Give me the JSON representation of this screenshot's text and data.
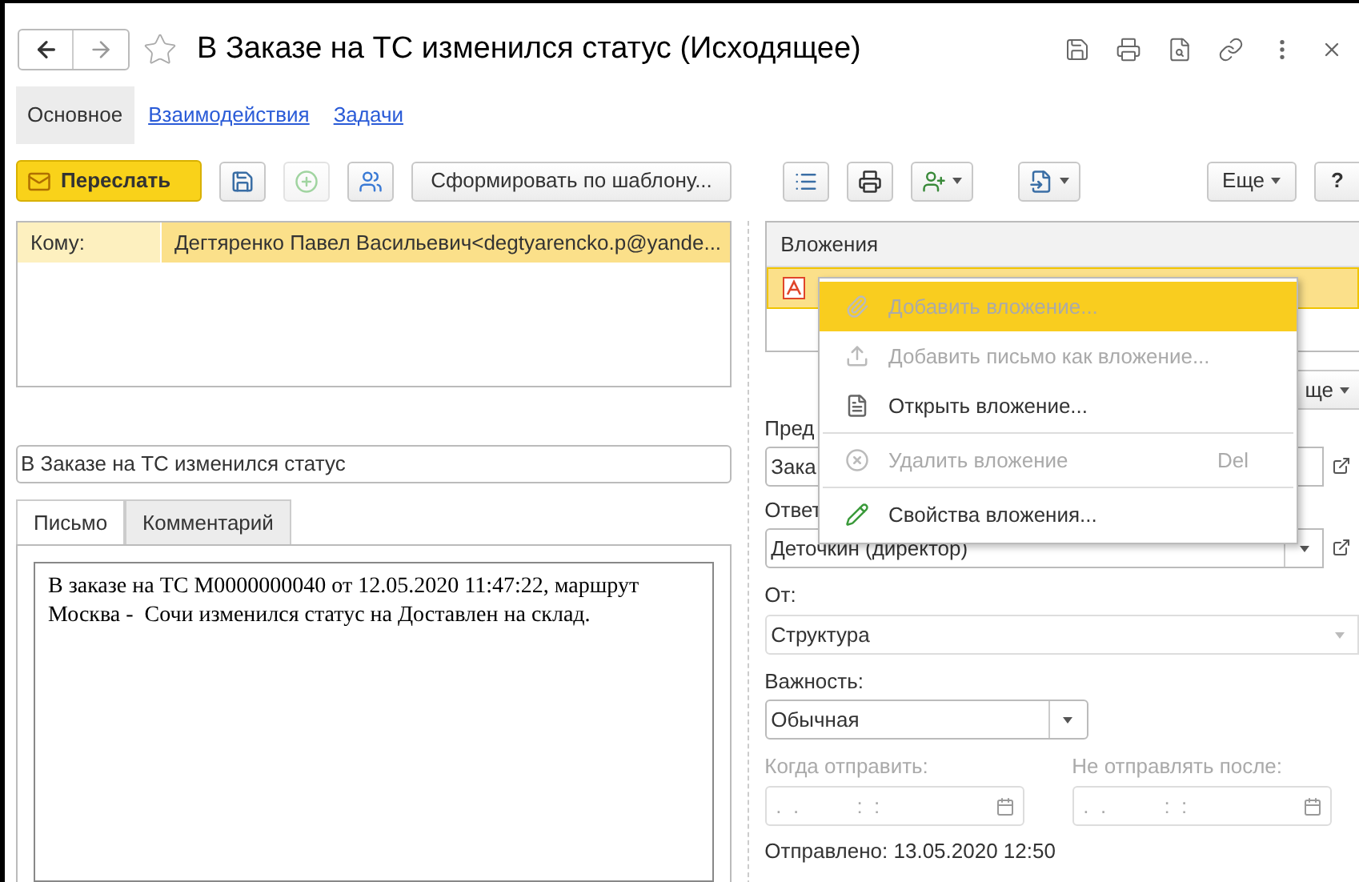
{
  "window": {
    "title": "В Заказе на ТС изменился статус (Исходящее)",
    "favorite": false
  },
  "nav_tabs": [
    {
      "label": "Основное",
      "selected": true
    },
    {
      "label": "Взаимодействия",
      "selected": false
    },
    {
      "label": "Задачи",
      "selected": false
    }
  ],
  "toolbar": {
    "forward": "Переслать",
    "template": "Сформировать по шаблону...",
    "more": "Еще",
    "help": "?"
  },
  "recipients": {
    "label": "Кому:",
    "value": "Дегтяренко Павел Васильевич<degtyarencko.p@yande..."
  },
  "subject": "В Заказе на ТС изменился статус",
  "body_tabs": [
    {
      "label": "Письмо",
      "selected": true
    },
    {
      "label": "Комментарий",
      "selected": false
    }
  ],
  "body_text": "В заказе на ТС М0000000040 от 12.05.2020 11:47:22, маршрут Москва -  Сочи изменился статус на Доставлен на склад.",
  "attachments": {
    "header": "Вложения",
    "rows": [
      {
        "selected": true
      }
    ]
  },
  "context_menu": [
    {
      "kind": "item",
      "label": "Добавить вложение...",
      "disabled": true,
      "selected": true
    },
    {
      "kind": "item",
      "label": "Добавить письмо как вложение...",
      "disabled": true,
      "selected": false
    },
    {
      "kind": "item",
      "label": "Открыть вложение...",
      "disabled": false,
      "selected": false
    },
    {
      "kind": "separator"
    },
    {
      "kind": "item",
      "label": "Удалить вложение",
      "shortcut": "Del",
      "disabled": true,
      "selected": false
    },
    {
      "kind": "separator"
    },
    {
      "kind": "item",
      "label": "Свойства вложения...",
      "disabled": false,
      "selected": false
    }
  ],
  "right_panel": {
    "more_button": "ще",
    "subject_label": "Пред",
    "subject_value": "Зака",
    "responsible_label": "Ответ",
    "responsible_value": "Деточкин (директор)",
    "from_label": "От:",
    "from_value": "Структура",
    "importance_label": "Важность:",
    "importance_value": "Обычная",
    "send_when": {
      "label": "Когда отправить:",
      "mask": ".  .          :  :",
      "disabled": true
    },
    "not_after": {
      "label": "Не отправлять после:",
      "mask": ".  .          :  :",
      "disabled": true
    },
    "sent": "Отправлено: 13.05.2020 12:50"
  }
}
